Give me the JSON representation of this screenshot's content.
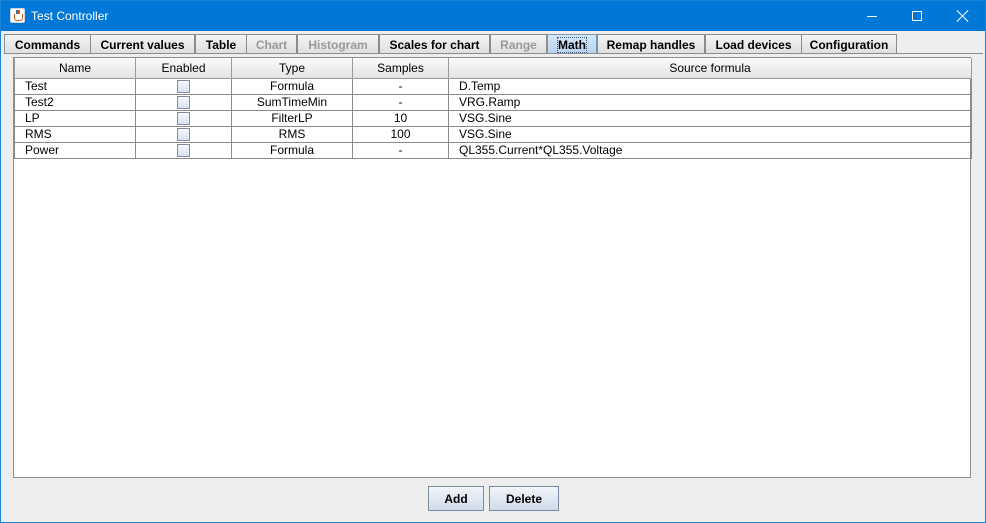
{
  "window": {
    "title": "Test Controller"
  },
  "tabs": [
    {
      "label": "Commands",
      "state": "normal"
    },
    {
      "label": "Current values",
      "state": "normal"
    },
    {
      "label": "Table",
      "state": "normal"
    },
    {
      "label": "Chart",
      "state": "disabled"
    },
    {
      "label": "Histogram",
      "state": "disabled"
    },
    {
      "label": "Scales for chart",
      "state": "normal"
    },
    {
      "label": "Range",
      "state": "disabled"
    },
    {
      "label": "Math",
      "state": "selected"
    },
    {
      "label": "Remap handles",
      "state": "normal"
    },
    {
      "label": "Load devices",
      "state": "normal"
    },
    {
      "label": "Configuration",
      "state": "normal"
    }
  ],
  "table": {
    "columns": [
      "Name",
      "Enabled",
      "Type",
      "Samples",
      "Source formula"
    ],
    "rows": [
      {
        "name": "Test",
        "enabled": false,
        "type": "Formula",
        "samples": "-",
        "source": "D.Temp"
      },
      {
        "name": "Test2",
        "enabled": false,
        "type": "SumTimeMin",
        "samples": "-",
        "source": "VRG.Ramp"
      },
      {
        "name": "LP",
        "enabled": false,
        "type": "FilterLP",
        "samples": "10",
        "source": "VSG.Sine"
      },
      {
        "name": "RMS",
        "enabled": false,
        "type": "RMS",
        "samples": "100",
        "source": "VSG.Sine"
      },
      {
        "name": "Power",
        "enabled": false,
        "type": "Formula",
        "samples": "-",
        "source": "QL355.Current*QL355.Voltage"
      }
    ]
  },
  "buttons": {
    "add": "Add",
    "delete": "Delete"
  },
  "colors": {
    "titlebar": "#0078d7",
    "selected_tab": "#b8d2ec",
    "disabled_text": "#9a9a9a"
  }
}
